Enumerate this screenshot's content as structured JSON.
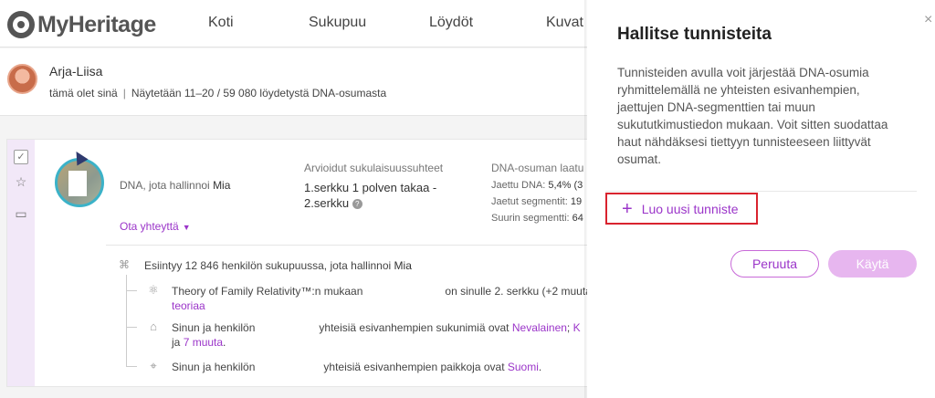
{
  "brand": {
    "name": "MyHeritage"
  },
  "nav": {
    "items": [
      {
        "label": "Koti"
      },
      {
        "label": "Sukupuu"
      },
      {
        "label": "Löydöt"
      },
      {
        "label": "Kuvat"
      }
    ]
  },
  "profile": {
    "name": "Arja-Liisa",
    "you_label": "tämä olet sinä",
    "results_text": "Näytetään 11–20 / 59 080 löydetystä DNA-osumasta"
  },
  "match": {
    "managed_prefix": "DNA, jota hallinnoi",
    "manager_name": "Mia",
    "contact_label": "Ota yhteyttä",
    "relationship_title": "Arvioidut sukulaisuussuhteet",
    "relationship_value": "1.serkku 1 polven takaa - 2.serkku",
    "quality_title": "DNA-osuman laatu",
    "shared_dna_label": "Jaettu DNA:",
    "shared_dna_value": "5,4% (3",
    "shared_segments_label": "Jaetut segmentit:",
    "shared_segments_value": "19",
    "largest_segment_label": "Suurin segmentti:",
    "largest_segment_value": "64",
    "tree_prefix": "Esiintyy 12 846 henkilön sukupuussa, jota hallinnoi",
    "tree_manager": "Mia",
    "theory_text_a": "Theory of Family Relativity™:n mukaan",
    "theory_text_b": "on sinulle 2. serkku (+2 muuta t",
    "theory_link": "teoriaa",
    "surnames_text_a": "Sinun ja henkilön",
    "surnames_text_b": "yhteisiä esivanhempien sukunimiä ovat",
    "surnames_link": "Nevalainen",
    "surnames_link2": "K",
    "surnames_more_prefix": "ja",
    "surnames_more_link": "7 muuta",
    "places_text_a": "Sinun ja henkilön",
    "places_text_b": "yhteisiä esivanhempien paikkoja ovat",
    "places_link": "Suomi"
  },
  "panel": {
    "close_glyph": "×",
    "title": "Hallitse tunnisteita",
    "description": "Tunnisteiden avulla voit järjestää DNA-osumia ryhmittelemällä ne yhteisten esivanhempien, jaettujen DNA-segmenttien tai muun sukututkimustiedon mukaan. Voit sitten suodattaa haut nähdäksesi tiettyyn tunnisteeseen liittyvät osumat.",
    "create_label": "Luo uusi tunniste",
    "cancel_label": "Peruuta",
    "apply_label": "Käytä"
  },
  "colors": {
    "accent": "#9b35c9",
    "highlight_border": "#d9232e",
    "apply_disabled": "#e7b6ef"
  }
}
